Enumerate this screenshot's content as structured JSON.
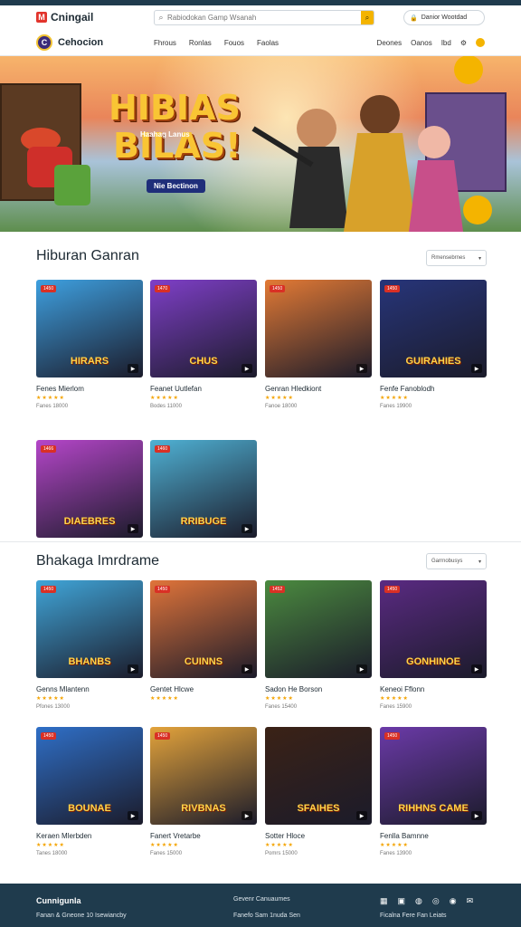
{
  "header": {
    "logo_text": "Cningail",
    "search_placeholder": "Rabiodokan Gamp Wsanah",
    "account_label": "Danior Wootdad"
  },
  "nav": {
    "brand": "Cehocion",
    "links": [
      "Fhrous",
      "Ronlas",
      "Fouos",
      "Faolas"
    ],
    "right_links": [
      "Deones",
      "Oanos",
      "Ibd"
    ]
  },
  "hero": {
    "title_line1": "HIBIAS",
    "title_line2": "BILAS!",
    "subtitle": "Haahag Lanus",
    "tagline": "Nie Bectinon"
  },
  "section1": {
    "title": "Hiburan Ganran",
    "dropdown": "Rmensebrnes",
    "cards": [
      {
        "title": "Fenes Mierlom",
        "meta": "Fanes 18000",
        "art": "HIRARS",
        "bg": "#3ea0e0",
        "tag": "1450"
      },
      {
        "title": "Feanet Uutlefan",
        "meta": "Bodes 11000",
        "art": "CHUS",
        "bg": "#7f3fc8",
        "tag": "1470"
      },
      {
        "title": "Genran Hledkiont",
        "meta": "Fanoe 18000",
        "art": "",
        "bg": "#e37a35",
        "tag": "1450"
      },
      {
        "title": "Fenfe Fanoblodh",
        "meta": "Fanes 19900",
        "art": "GUIRAHIES",
        "bg": "#27357a",
        "tag": "1450"
      },
      {
        "title": "",
        "meta": "",
        "art": "DIAEBRES",
        "bg": "#b546c9",
        "tag": "1466"
      },
      {
        "title": "",
        "meta": "",
        "art": "RRIBUGE",
        "bg": "#4fb1d4",
        "tag": "1460"
      }
    ]
  },
  "section2": {
    "title": "Bhakaga Imrdrame",
    "dropdown": "Garrnobusys",
    "cards": [
      {
        "title": "Genns Mlantenn",
        "meta": "Pfones 13000",
        "art": "BHANBS",
        "bg": "#40a5d8",
        "tag": "1450"
      },
      {
        "title": "Gentet Hlcwe",
        "meta": "",
        "art": "CUINNS",
        "bg": "#e0743a",
        "tag": "1450"
      },
      {
        "title": "Sadon He Borson",
        "meta": "Fanes 15400",
        "art": "",
        "bg": "#4b8a3f",
        "tag": "1452"
      },
      {
        "title": "Keneoi Fflonn",
        "meta": "Fanes 15900",
        "art": "GONHINOE",
        "bg": "#5a2a82",
        "tag": "1450"
      },
      {
        "title": "Keraen Mlerbden",
        "meta": "Tanes 18000",
        "art": "BOUNAE",
        "bg": "#2f6fc7",
        "tag": "1450"
      },
      {
        "title": "Fanert Vretarbe",
        "meta": "Fanes 15000",
        "art": "RIVBNAS",
        "bg": "#e3a33b",
        "tag": "1450"
      },
      {
        "title": "Sotter Hloce",
        "meta": "Pomrs 15000",
        "art": "SFAIHES",
        "bg": "#3b2216",
        "tag": ""
      },
      {
        "title": "Fenlla Bamnne",
        "meta": "Fanes 13900",
        "art": "RIHHNS CAME",
        "bg": "#6b3aa8",
        "tag": "1450"
      }
    ]
  },
  "footer": {
    "brand": "Cunnigunla",
    "copy": "Fanan & Gneone 10 Isewiancby",
    "col2_title": "Gevenr Canuaumes",
    "col2_line": "Fanefo Sam 1nuda Sen",
    "col3_line": "Ficalna Fere Fan Leiats"
  },
  "colors": {
    "accent": "#f4b400",
    "brand": "#e2342c",
    "footer_bg": "#1f3b4d"
  }
}
